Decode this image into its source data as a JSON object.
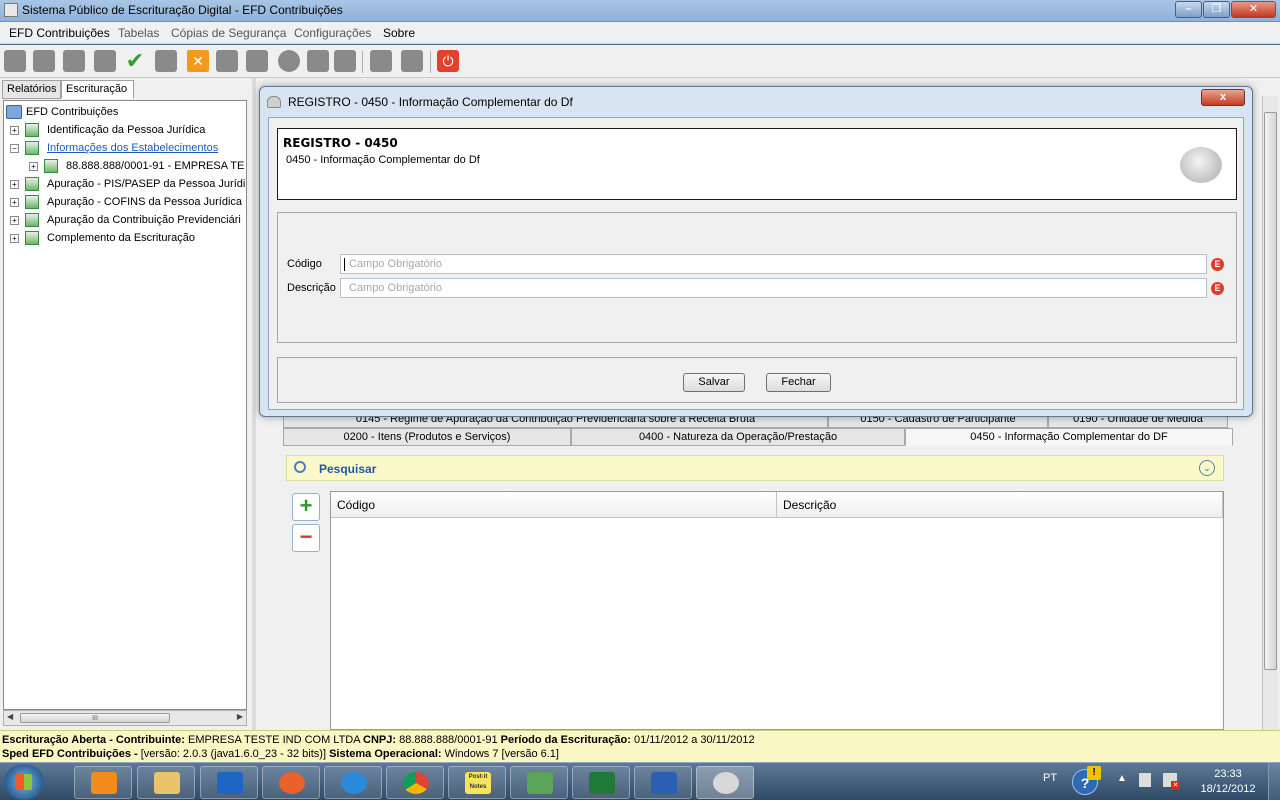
{
  "window": {
    "title": "Sistema Público de Escrituração Digital - EFD Contribuições",
    "controls": [
      "minimize",
      "maximize",
      "close"
    ]
  },
  "menu": [
    "EFD Contribuições",
    "Tabelas",
    "Cópias de Segurança",
    "Configurações",
    "Sobre"
  ],
  "toolbar_icons": [
    "new-file-icon",
    "open-file-icon",
    "folder-icon",
    "settings-gear-icon",
    "check-icon",
    "copy-icon",
    "cancel-icon",
    "signature-icon",
    "tools-icon",
    "globe-icon",
    "send-icon",
    "shield-icon",
    "save-icon",
    "print-icon",
    "power-icon"
  ],
  "left_panel": {
    "tabs": [
      "Relatórios",
      "Escrituração"
    ],
    "tree": {
      "root": "EFD Contribuições",
      "items": [
        "Identificação da Pessoa Jurídica",
        "Informações dos Estabelecimentos",
        "88.888.888/0001-91  -  EMPRESA TE",
        "Apuração - PIS/PASEP da Pessoa Jurídi",
        "Apuração - COFINS da Pessoa Jurídica",
        "Apuração da Contribuição Previdenciári",
        "Complemento da Escrituração"
      ]
    },
    "hscroll_grip": "III"
  },
  "register_tabs": {
    "row1": [
      "0145 - Regime de Apuração da Contribuição Previdenciária sobre a Receita Bruta",
      "0150 - Cadastro de Participante",
      "0190 - Unidade de Medida"
    ],
    "row2": [
      "0200 - Itens (Produtos e Serviços)",
      "0400 - Natureza da Operação/Prestação",
      "0450 - Informação Complementar do DF"
    ]
  },
  "search": {
    "label": "Pesquisar"
  },
  "grid": {
    "columns": [
      "Código",
      "Descrição"
    ],
    "add_symbol": "+",
    "remove_symbol": "−"
  },
  "dialog": {
    "title": "REGISTRO - 0450 - Informação Complementar do Df",
    "close_symbol": "x",
    "header_title": "REGISTRO - 0450",
    "header_subtitle": "0450 - Informação Complementar do Df",
    "fields": [
      {
        "label": "Código",
        "placeholder": "Campo Obrigatório",
        "value": "",
        "error_marker": "E"
      },
      {
        "label": "Descrição",
        "placeholder": "Campo Obrigatório",
        "value": "",
        "error_marker": "E"
      }
    ],
    "buttons": {
      "save": "Salvar",
      "close": "Fechar"
    }
  },
  "status": {
    "line1_label": "Escrituração Aberta - Contribuinte:",
    "line1_company": "EMPRESA TESTE IND COM LTDA",
    "line1_cnpj_label": "CNPJ:",
    "line1_cnpj": "88.888.888/0001-91",
    "line1_period_label": "Período da Escrituração:",
    "line1_period": "01/11/2012 a 30/11/2012",
    "line2_label": "Sped EFD Contribuições -",
    "line2_version": "[versão: 2.0.3 (java1.6.0_23 - 32 bits)]",
    "line2_os_label": "Sistema Operacional:",
    "line2_os": "Windows 7 [versão 6.1]"
  },
  "taskbar": {
    "apps": [
      "media-player-icon",
      "file-explorer-icon",
      "task-app-icon",
      "firefox-icon",
      "internet-explorer-icon",
      "chrome-icon",
      "sticky-notes-icon",
      "messenger-icon",
      "excel-icon",
      "word-icon",
      "sped-app-icon"
    ],
    "sticky_label": "Post-it Notes",
    "language": "PT",
    "warning_symbol": "!",
    "help_symbol": "?",
    "tray_up_symbol": "▲",
    "time": "23:33",
    "date": "18/12/2012"
  },
  "colors": {
    "accent": "#2456a8",
    "status_bg": "#fbf7c4",
    "search_bg": "#fbf9c9",
    "error": "#e03a2a"
  }
}
